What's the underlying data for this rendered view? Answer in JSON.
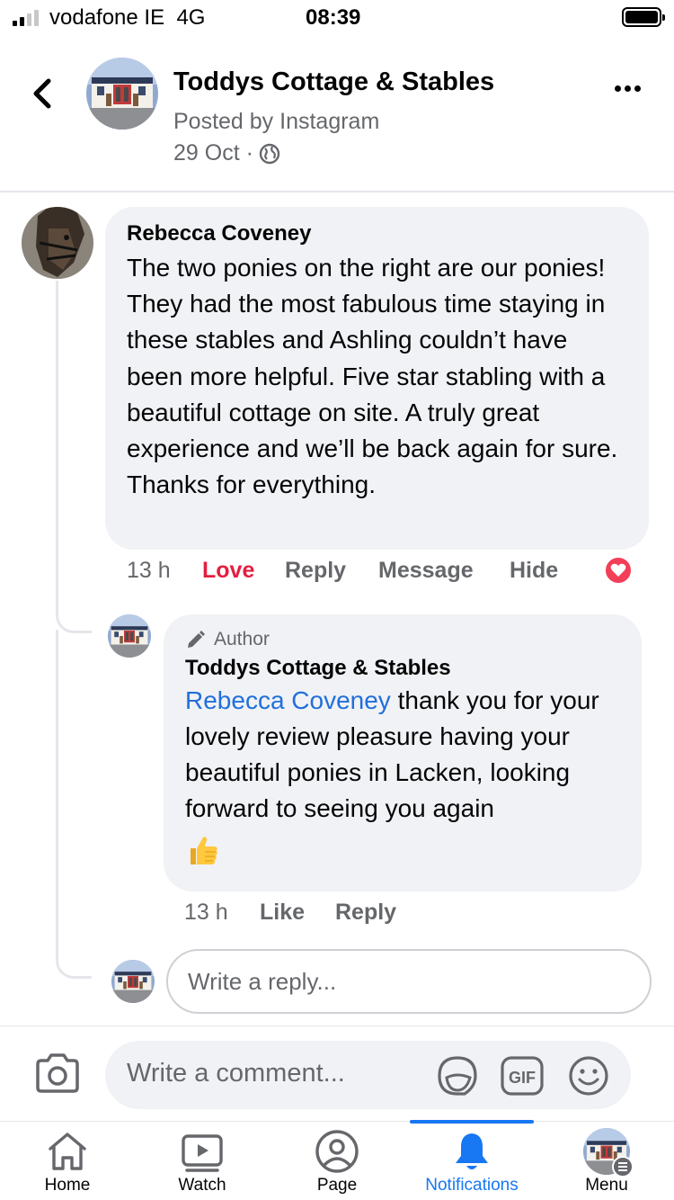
{
  "status_bar": {
    "carrier": "vodafone IE",
    "network": "4G",
    "time": "08:39"
  },
  "post": {
    "page_name": "Toddys Cottage & Stables",
    "posted_by": "Posted by Instagram",
    "date": "29 Oct ·"
  },
  "comment": {
    "author": "Rebecca Coveney",
    "text": "The two ponies on the right are our ponies! They had the most fabulous time staying in these stables and Ashling couldn’t have been more helpful. Five star stabling with a beautiful cottage on site. A truly great experience and we’ll be back again for sure. Thanks for everything.",
    "time": "13 h",
    "actions": {
      "love": "Love",
      "reply": "Reply",
      "message": "Message",
      "hide": "Hide"
    },
    "reaction_count": "1"
  },
  "reply": {
    "badge": "Author",
    "author": "Toddys Cottage & Stables",
    "mention": "Rebecca Coveney",
    "text": " thank you for your lovely review pleasure having your beautiful ponies in Lacken, looking forward to seeing you again",
    "time": "13 h",
    "actions": {
      "like": "Like",
      "reply": "Reply"
    }
  },
  "reply_box": {
    "placeholder": "Write a reply..."
  },
  "composer": {
    "placeholder": "Write a comment..."
  },
  "bottom_nav": {
    "items": [
      {
        "label": "Home",
        "icon": "home-icon"
      },
      {
        "label": "Watch",
        "icon": "watch-icon"
      },
      {
        "label": "Page",
        "icon": "page-icon"
      },
      {
        "label": "Notifications",
        "icon": "bell-icon",
        "active": true
      },
      {
        "label": "Menu",
        "icon": "menu-avatar"
      }
    ]
  },
  "colors": {
    "accent": "#1877f2",
    "love": "#e41e3f",
    "mention": "#216fdb",
    "bubble": "#f0f2f5",
    "secondary_text": "#65676b"
  }
}
